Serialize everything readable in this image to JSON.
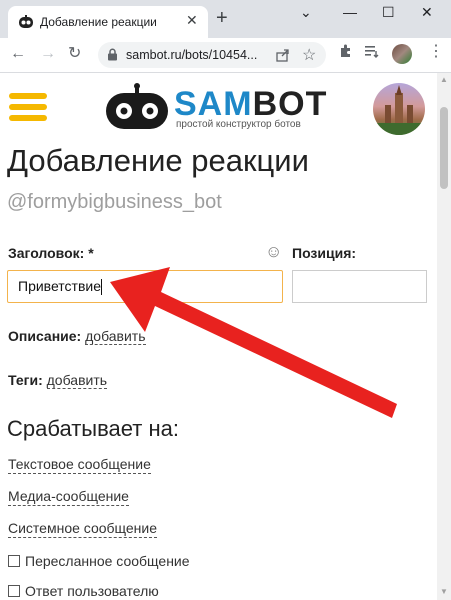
{
  "browser": {
    "tab_title": "Добавление реакции",
    "url": "sambot.ru/bots/10454...",
    "new_tab": "+",
    "tab_close": "✕",
    "minimize": "—",
    "maximize": "☐",
    "close": "✕"
  },
  "header": {
    "logo_sam": "SAM",
    "logo_bot": "BOT",
    "tagline": "простой конструктор ботов"
  },
  "page": {
    "title": "Добавление реакции",
    "subtitle": "@formybigbusiness_bot"
  },
  "form": {
    "title_label": "Заголовок: *",
    "title_value": "Приветствие",
    "position_label": "Позиция:",
    "description_label": "Описание:",
    "description_link": "добавить",
    "tags_label": "Теги:",
    "tags_link": "добавить"
  },
  "triggers": {
    "heading": "Срабатывает на:",
    "text_message": "Текстовое сообщение",
    "media_message": "Медиа-сообщение",
    "system_message": "Системное сообщение",
    "forwarded": "Пересланное сообщение",
    "user_reply": "Ответ пользователю"
  },
  "colors": {
    "accent_yellow": "#f5b800",
    "logo_blue": "#1e88c8",
    "arrow_red": "#e8221f",
    "input_focus": "#f3b34c"
  }
}
